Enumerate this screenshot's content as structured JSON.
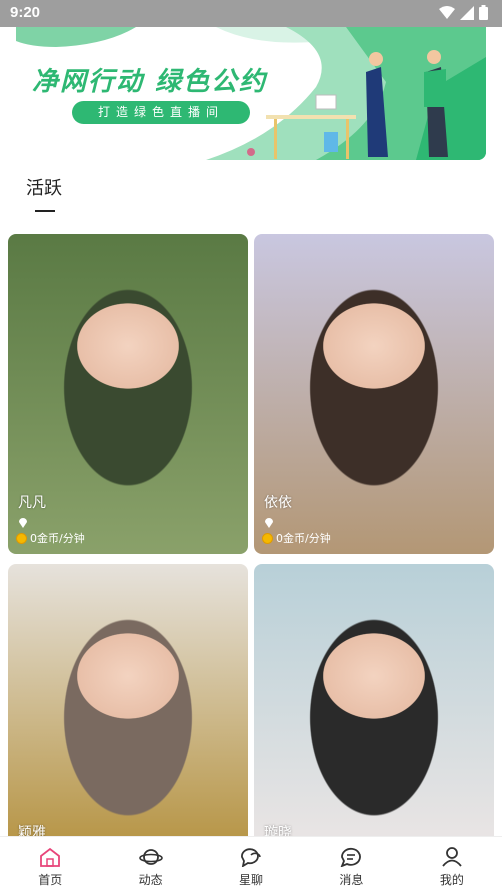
{
  "status_bar": {
    "time": "9:20"
  },
  "banner": {
    "title": "净网行动  绿色公约",
    "pill_text": "打造绿色直播间"
  },
  "section": {
    "title": "活跃"
  },
  "cards": [
    {
      "name": "凡凡",
      "price": "0金币/分钟",
      "bg": [
        "#5a7a44",
        "#8aa16a",
        "#3a4a30"
      ]
    },
    {
      "name": "依依",
      "price": "0金币/分钟",
      "bg": [
        "#c9c7e0",
        "#b39775",
        "#3d2f28"
      ]
    },
    {
      "name": "颖雅",
      "price": "",
      "bg": [
        "#e6e2dc",
        "#b08a30",
        "#7a6a60"
      ]
    },
    {
      "name": "璇晓",
      "price": "",
      "bg": [
        "#b8d0d8",
        "#f1e8e6",
        "#2a2a2a"
      ]
    }
  ],
  "tabs": [
    {
      "label": "首页",
      "icon": "home-icon",
      "active": true
    },
    {
      "label": "动态",
      "icon": "planet-icon",
      "active": false
    },
    {
      "label": "星聊",
      "icon": "chat-bubbles-icon",
      "active": false
    },
    {
      "label": "消息",
      "icon": "message-icon",
      "active": false
    },
    {
      "label": "我的",
      "icon": "person-icon",
      "active": false
    }
  ],
  "colors": {
    "accent": "#e8457a",
    "banner_green": "#2eb873"
  }
}
